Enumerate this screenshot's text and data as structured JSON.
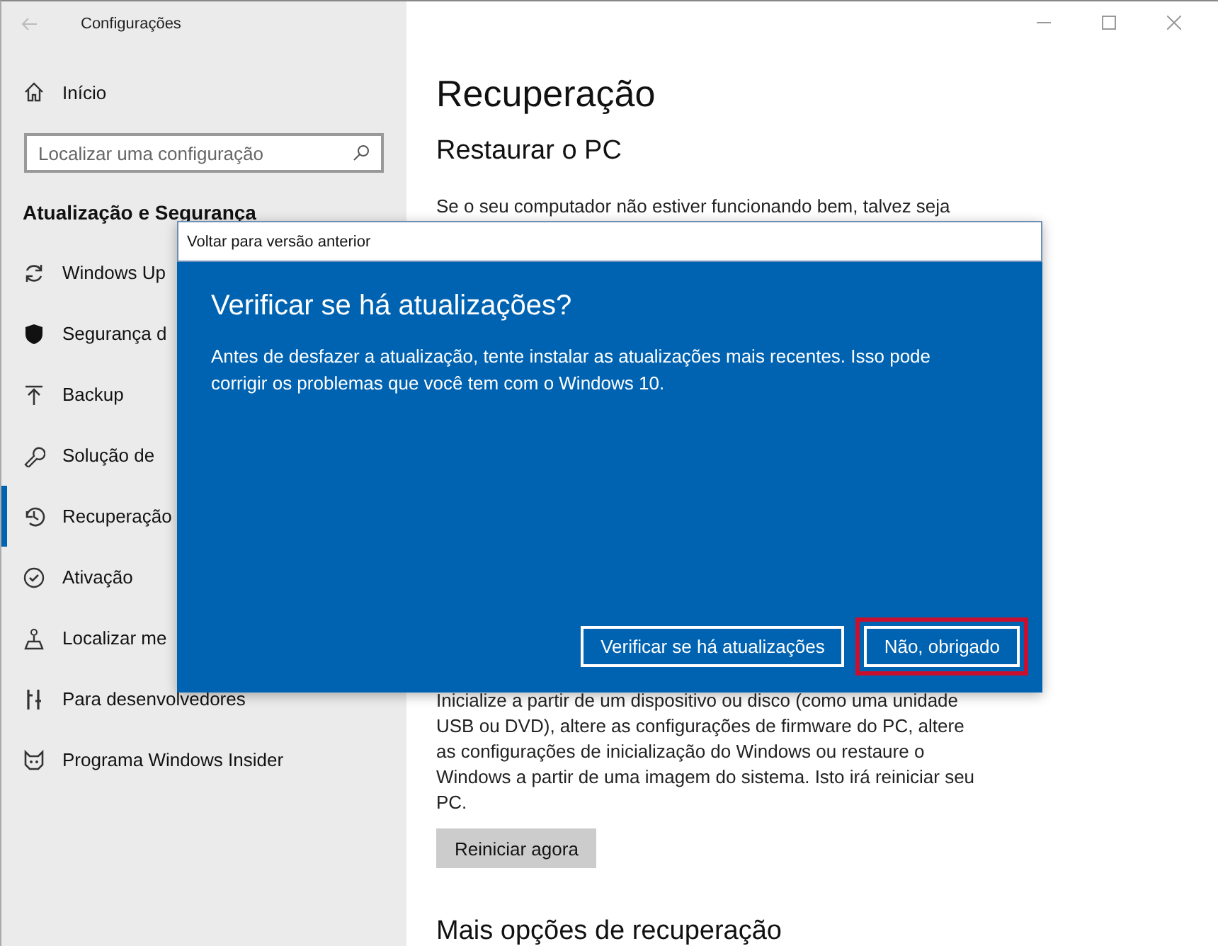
{
  "window": {
    "title": "Configurações"
  },
  "sidebar": {
    "home": "Início",
    "search": {
      "placeholder": "Localizar uma configuração"
    },
    "heading": "Atualização e Segurança",
    "items": [
      {
        "label": "Windows Up",
        "selected": false
      },
      {
        "label": "Segurança d",
        "selected": false
      },
      {
        "label": "Backup",
        "selected": false
      },
      {
        "label": "Solução de",
        "selected": false
      },
      {
        "label": "Recuperação",
        "selected": true
      },
      {
        "label": "Ativação",
        "selected": false
      },
      {
        "label": "Localizar me",
        "selected": false
      },
      {
        "label": "Para desenvolvedores",
        "selected": false
      },
      {
        "label": "Programa Windows Insider",
        "selected": false
      }
    ]
  },
  "content": {
    "title": "Recuperação",
    "section": "Restaurar o PC",
    "intro": "Se o seu computador não estiver funcionando bem, talvez seja",
    "advanced_text": "Inicialize a partir de um dispositivo ou disco (como uma unidade USB ou DVD), altere as configurações de firmware do PC, altere as configurações de inicialização do Windows ou restaure o Windows a partir de uma imagem do sistema. Isto irá reiniciar seu PC.",
    "restart_button": "Reiniciar agora",
    "more_heading": "Mais opções de recuperação"
  },
  "dialog": {
    "title": "Voltar para versão anterior",
    "heading": "Verificar se há atualizações?",
    "body": "Antes de desfazer a atualização, tente instalar as atualizações mais recentes. Isso pode corrigir os problemas que você tem com o Windows 10.",
    "buttons": [
      {
        "label": "Verificar se há atualizações",
        "highlighted": false
      },
      {
        "label": "Não, obrigado",
        "highlighted": true
      }
    ]
  }
}
